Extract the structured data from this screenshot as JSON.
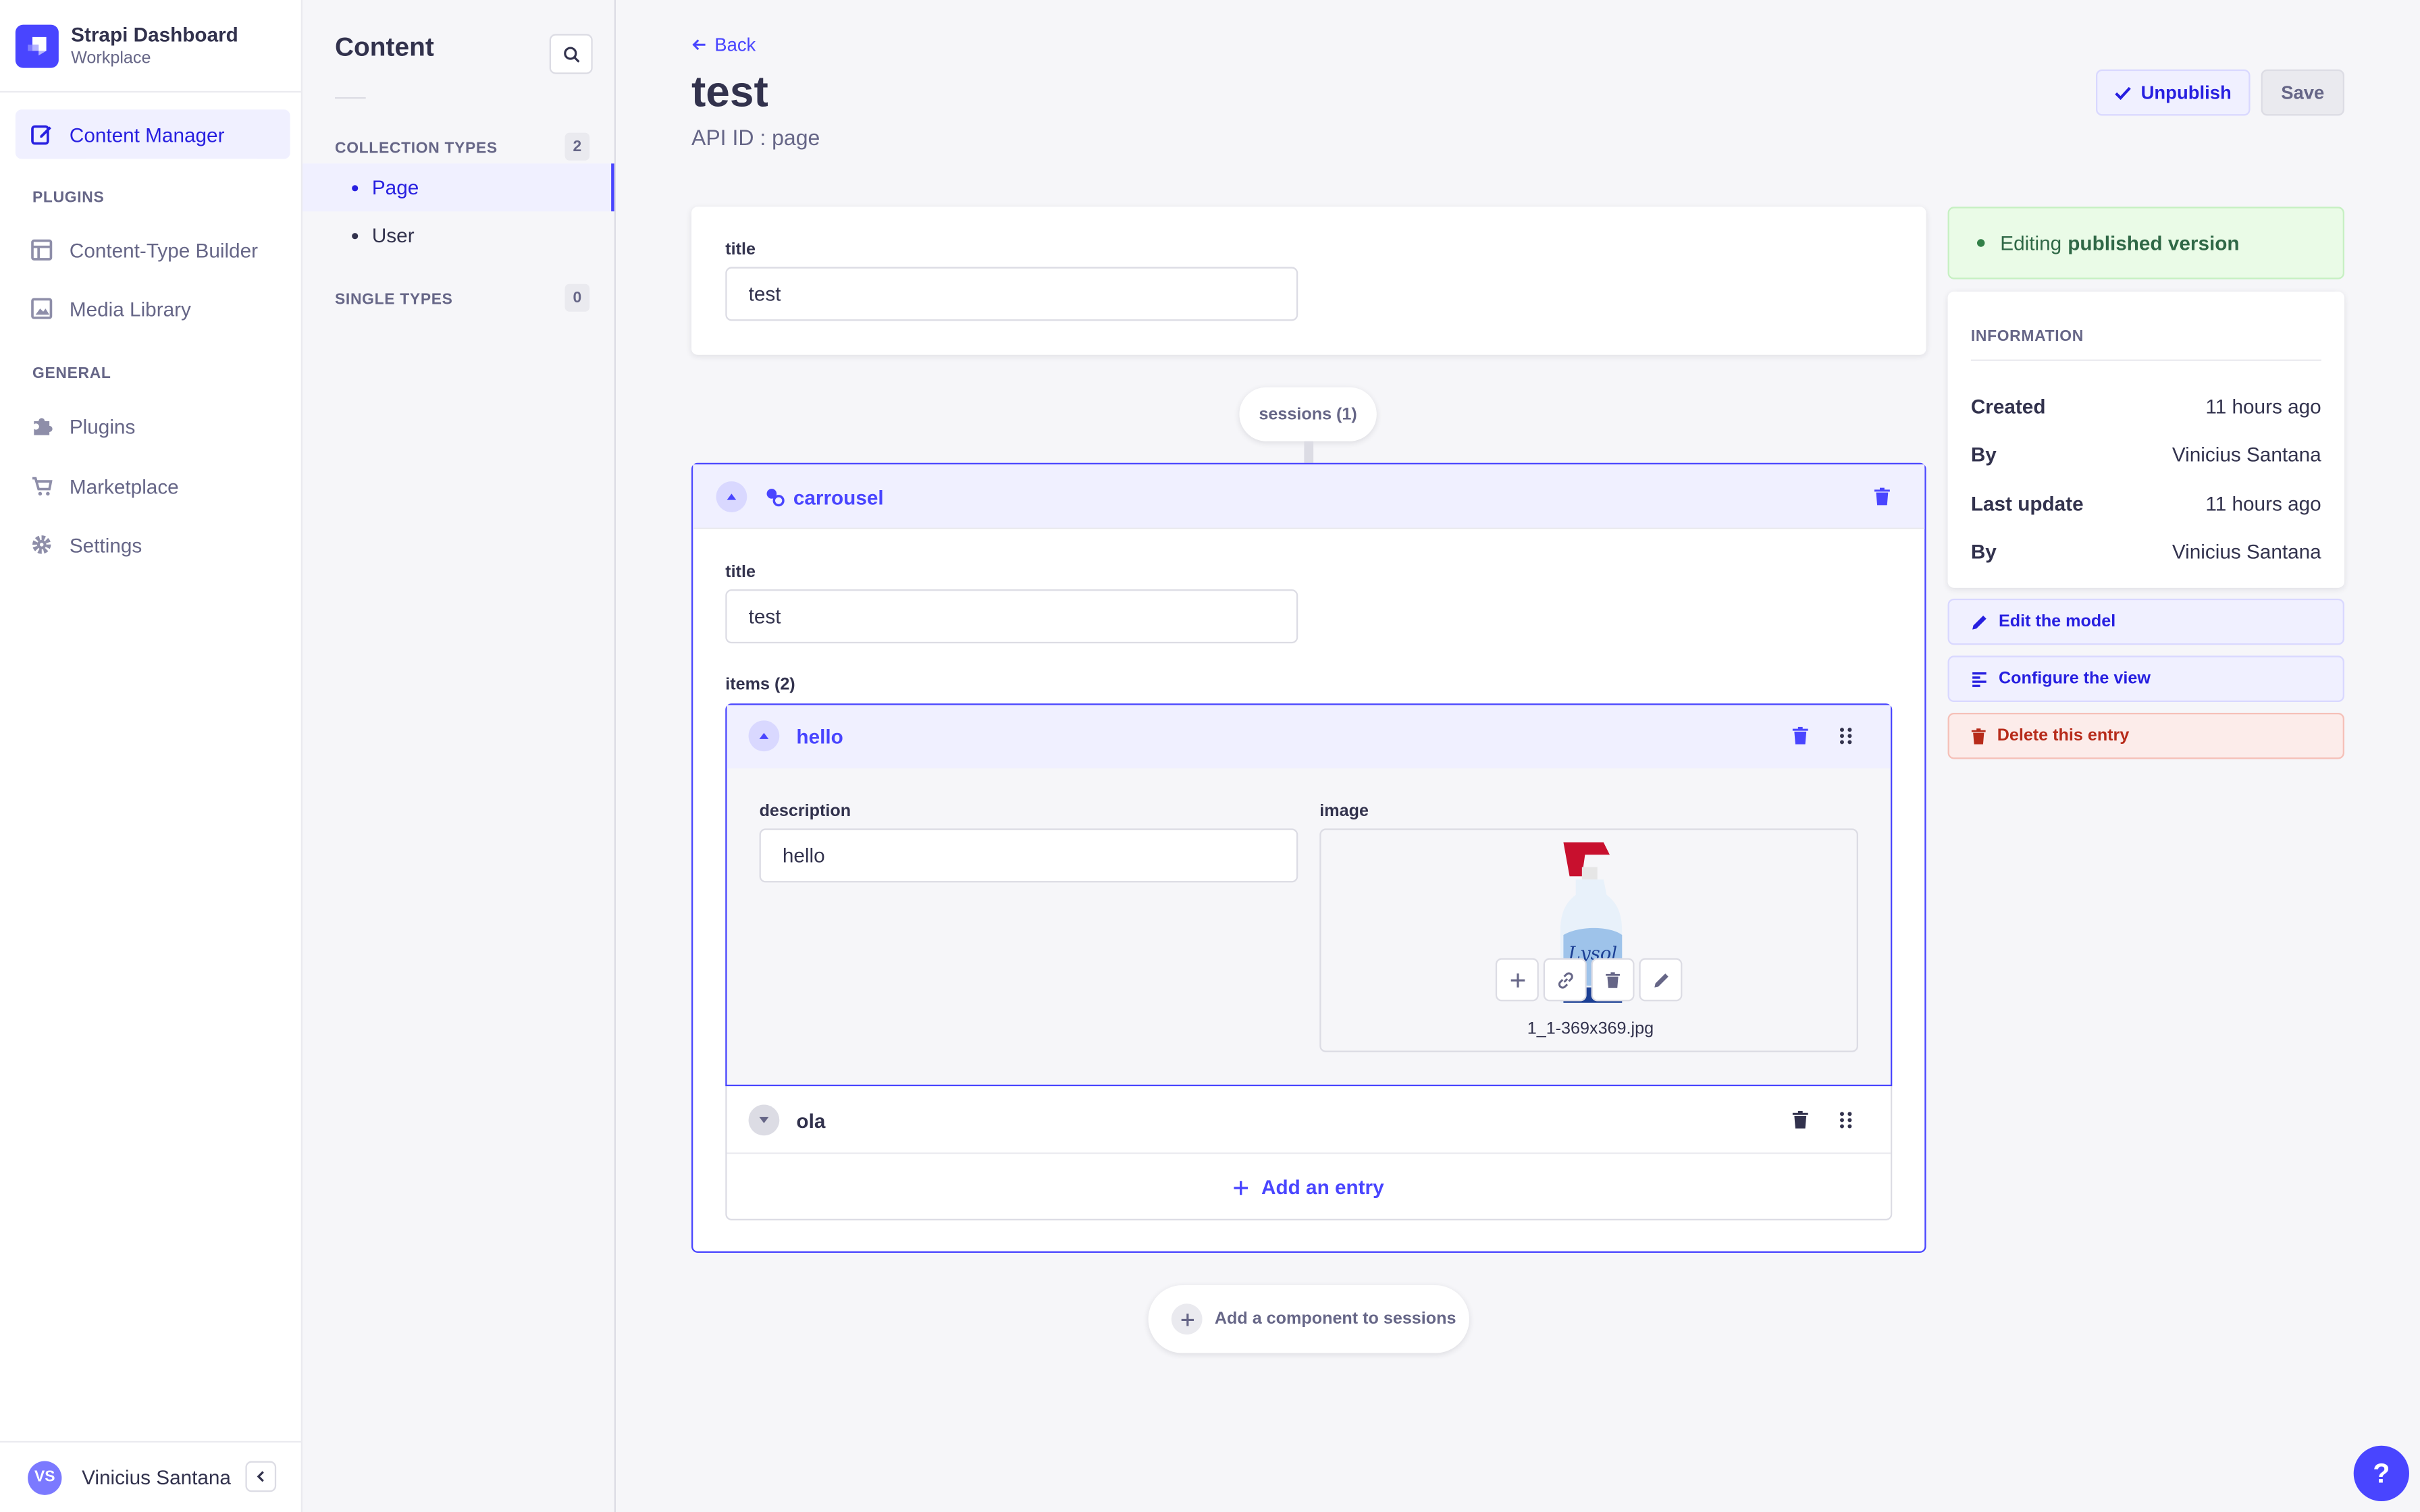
{
  "brand": {
    "title": "Strapi Dashboard",
    "subtitle": "Workplace"
  },
  "mainnav": {
    "content_manager": "Content Manager",
    "plugins_section": "PLUGINS",
    "content_type_builder": "Content-Type Builder",
    "media_library": "Media Library",
    "general_section": "GENERAL",
    "plugins": "Plugins",
    "marketplace": "Marketplace",
    "settings": "Settings",
    "user_initials": "VS",
    "user_name": "Vinicius Santana"
  },
  "subnav": {
    "title": "Content",
    "collection_types": "COLLECTION TYPES",
    "collection_count": "2",
    "items": [
      {
        "label": "Page"
      },
      {
        "label": "User"
      }
    ],
    "single_types": "SINGLE TYPES",
    "single_count": "0"
  },
  "header": {
    "back": "Back",
    "title": "test",
    "api_id": "API ID : page",
    "unpublish": "Unpublish",
    "save": "Save"
  },
  "form": {
    "title_label": "title",
    "title_value": "test",
    "dz_pill": "sessions (1)",
    "component_name": "carrousel",
    "comp_title_label": "title",
    "comp_title_value": "test",
    "items_label": "items (2)",
    "item1": {
      "name": "hello",
      "description_label": "description",
      "description_value": "hello",
      "image_label": "image",
      "image_name": "1_1-369x369.jpg"
    },
    "item2": {
      "name": "ola"
    },
    "add_entry": "Add an entry",
    "add_component": "Add a component to sessions"
  },
  "sidebar": {
    "editing_prefix": "Editing",
    "editing_bold": "published version",
    "info_title": "INFORMATION",
    "rows": [
      {
        "k": "Created",
        "v": "11 hours ago"
      },
      {
        "k": "By",
        "v": "Vinicius Santana"
      },
      {
        "k": "Last update",
        "v": "11 hours ago"
      },
      {
        "k": "By",
        "v": "Vinicius Santana"
      }
    ],
    "edit_model": "Edit the model",
    "configure_view": "Configure the view",
    "delete_entry": "Delete this entry"
  },
  "help": "?",
  "colors": {
    "primary": "#4945ff",
    "danger": "#b72b1a",
    "success": "#328048"
  }
}
